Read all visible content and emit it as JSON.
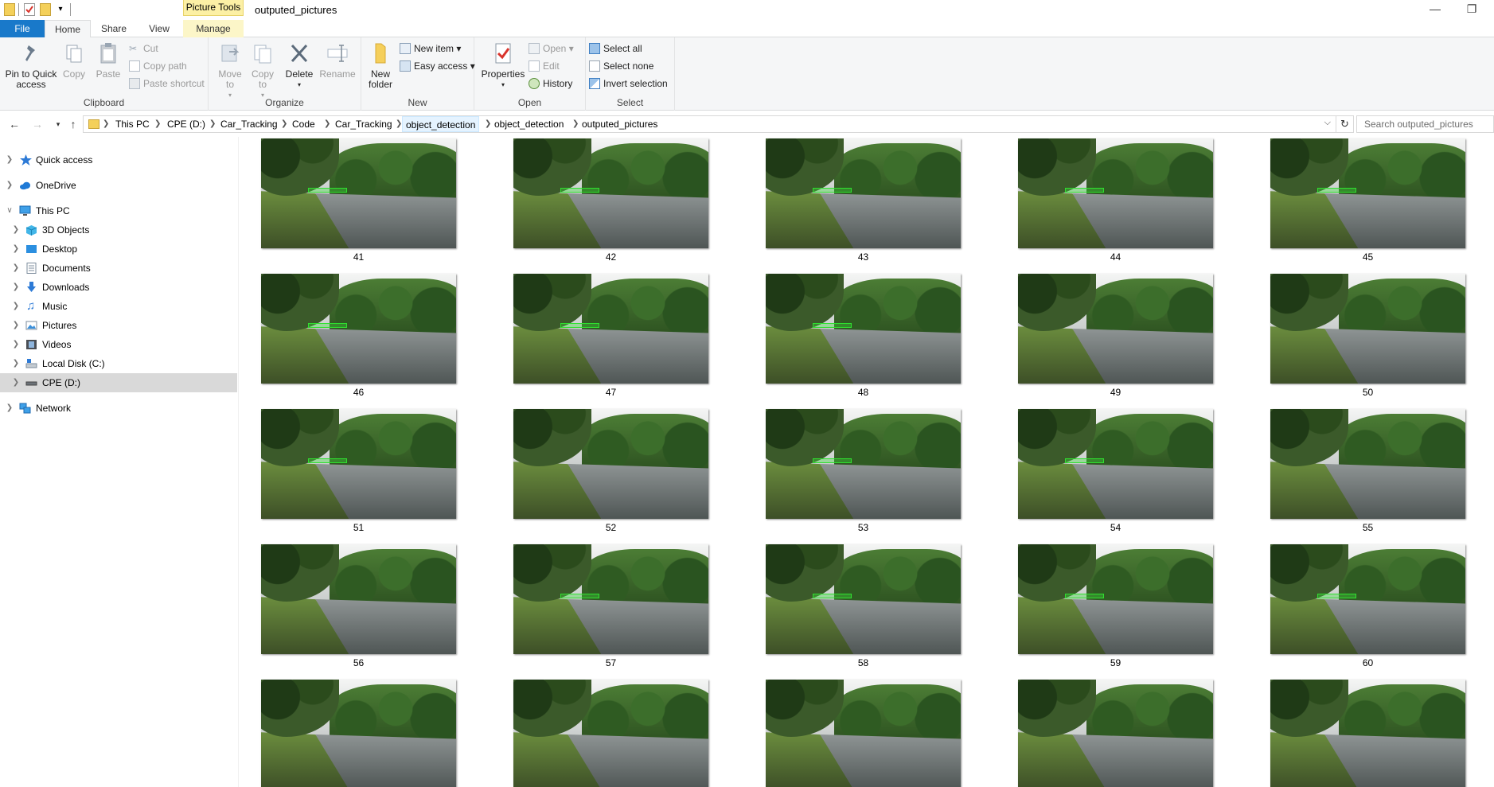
{
  "window": {
    "title": "outputed_pictures",
    "context_group": "Picture Tools"
  },
  "tabs": {
    "file": "File",
    "home": "Home",
    "share": "Share",
    "view": "View",
    "manage": "Manage"
  },
  "ribbon": {
    "clipboard": {
      "label": "Clipboard",
      "pin": "Pin to Quick access",
      "copy": "Copy",
      "paste": "Paste",
      "cut": "Cut",
      "copy_path": "Copy path",
      "paste_shortcut": "Paste shortcut"
    },
    "organize": {
      "label": "Organize",
      "move_to": "Move to",
      "copy_to": "Copy to",
      "delete": "Delete",
      "rename": "Rename"
    },
    "new": {
      "label": "New",
      "new_folder": "New folder",
      "new_item": "New item",
      "easy_access": "Easy access"
    },
    "open": {
      "label": "Open",
      "properties": "Properties",
      "open": "Open",
      "edit": "Edit",
      "history": "History"
    },
    "select": {
      "label": "Select",
      "select_all": "Select all",
      "select_none": "Select none",
      "invert_selection": "Invert selection"
    }
  },
  "address": {
    "crumbs": [
      "This PC",
      "CPE (D:)",
      "Car_Tracking",
      "Code",
      "Car_Tracking",
      "object_detection",
      "object_detection",
      "outputed_pictures"
    ],
    "search_placeholder": "Search outputed_pictures"
  },
  "navpane": {
    "quick_access": "Quick access",
    "onedrive": "OneDrive",
    "this_pc": "This PC",
    "objects3d": "3D Objects",
    "desktop": "Desktop",
    "documents": "Documents",
    "downloads": "Downloads",
    "music": "Music",
    "pictures": "Pictures",
    "videos": "Videos",
    "local_disk": "Local Disk (C:)",
    "cpe": "CPE (D:)",
    "network": "Network"
  },
  "files": [
    {
      "name": "41",
      "detected": true
    },
    {
      "name": "42",
      "detected": true
    },
    {
      "name": "43",
      "detected": true
    },
    {
      "name": "44",
      "detected": true
    },
    {
      "name": "45",
      "detected": true
    },
    {
      "name": "46",
      "detected": true
    },
    {
      "name": "47",
      "detected": true
    },
    {
      "name": "48",
      "detected": true
    },
    {
      "name": "49",
      "detected": false
    },
    {
      "name": "50",
      "detected": false
    },
    {
      "name": "51",
      "detected": true
    },
    {
      "name": "52",
      "detected": false
    },
    {
      "name": "53",
      "detected": true
    },
    {
      "name": "54",
      "detected": true
    },
    {
      "name": "55",
      "detected": false
    },
    {
      "name": "56",
      "detected": false
    },
    {
      "name": "57",
      "detected": true
    },
    {
      "name": "58",
      "detected": true
    },
    {
      "name": "59",
      "detected": true
    },
    {
      "name": "60",
      "detected": true
    },
    {
      "name": "",
      "detected": false
    },
    {
      "name": "",
      "detected": false
    },
    {
      "name": "",
      "detected": false
    },
    {
      "name": "",
      "detected": false
    },
    {
      "name": "",
      "detected": false
    }
  ]
}
